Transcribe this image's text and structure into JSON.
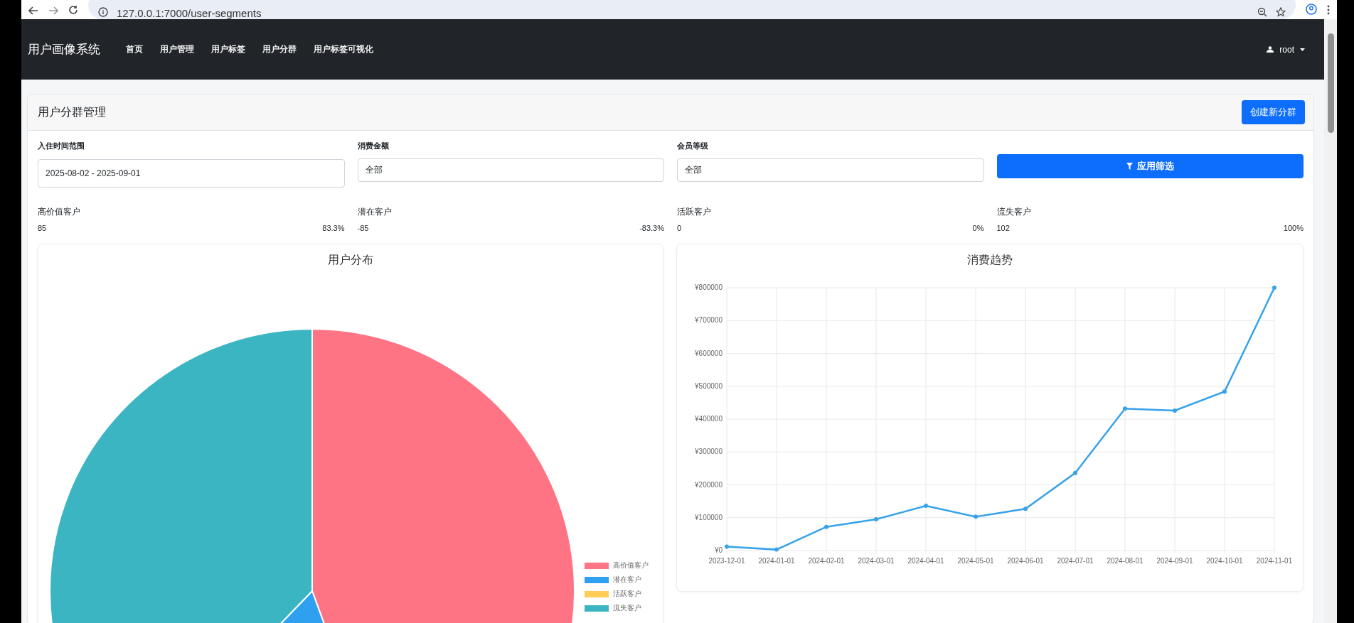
{
  "browser": {
    "url": "127.0.0.1:7000/user-segments"
  },
  "navbar": {
    "brand": "用户画像系统",
    "items": [
      {
        "label": "首页",
        "selected": false
      },
      {
        "label": "用户管理",
        "selected": false
      },
      {
        "label": "用户标签",
        "selected": false
      },
      {
        "label": "用户分群",
        "selected": false
      },
      {
        "label": "用户标签可视化",
        "selected": false
      }
    ],
    "user": "root"
  },
  "page": {
    "title": "用户分群管理",
    "create_button": "创建新分群"
  },
  "filters": [
    {
      "label": "入住时间范围",
      "value": "2025-08-02 - 2025-09-01",
      "kind": "date"
    },
    {
      "label": "消费金额",
      "value": "全部",
      "kind": "select"
    },
    {
      "label": "会员等级",
      "value": "全部",
      "kind": "select"
    }
  ],
  "apply_button": "应用筛选",
  "stats": [
    {
      "label": "高价值客户",
      "value": "85",
      "percent": "83.3%"
    },
    {
      "label": "潜在客户",
      "value": "-85",
      "percent": "-83.3%"
    },
    {
      "label": "活跃客户",
      "value": "0",
      "percent": "0%"
    },
    {
      "label": "流失客户",
      "value": "102",
      "percent": "100%"
    }
  ],
  "distribution": {
    "title": "用户分布",
    "legend": [
      {
        "label": "高价值客户",
        "color": "#ff7485"
      },
      {
        "label": "潜在客户",
        "color": "#2f9ff0"
      },
      {
        "label": "活跃客户",
        "color": "#ffcd56"
      },
      {
        "label": "流失客户",
        "color": "#3bb5c2"
      }
    ]
  },
  "trend": {
    "title": "消费趋势",
    "chart_data": {
      "type": "line",
      "categories": [
        "2023-12-01",
        "2024-01-01",
        "2024-02-01",
        "2024-03-01",
        "2024-04-01",
        "2024-05-01",
        "2024-06-01",
        "2024-07-01",
        "2024-08-01",
        "2024-09-01",
        "2024-10-01",
        "2024-11-01"
      ],
      "grid": true,
      "series": [
        {
          "color": "#36a2eb",
          "marker": true,
          "values": [
            12000,
            3000,
            72000,
            95000,
            136000,
            103000,
            127000,
            236000,
            432000,
            426000,
            484000,
            800000
          ]
        }
      ],
      "ylim": [
        0,
        800000
      ],
      "yticks": [
        {
          "value": 0,
          "label": "¥0"
        },
        {
          "value": 100000,
          "label": "¥100000"
        },
        {
          "value": 200000,
          "label": "¥200000"
        },
        {
          "value": 300000,
          "label": "¥300000"
        },
        {
          "value": 400000,
          "label": "¥400000"
        },
        {
          "value": 500000,
          "label": "¥500000"
        },
        {
          "value": 600000,
          "label": "¥600000"
        },
        {
          "value": 700000,
          "label": "¥700000"
        },
        {
          "value": 800000,
          "label": "¥800000"
        }
      ]
    }
  }
}
